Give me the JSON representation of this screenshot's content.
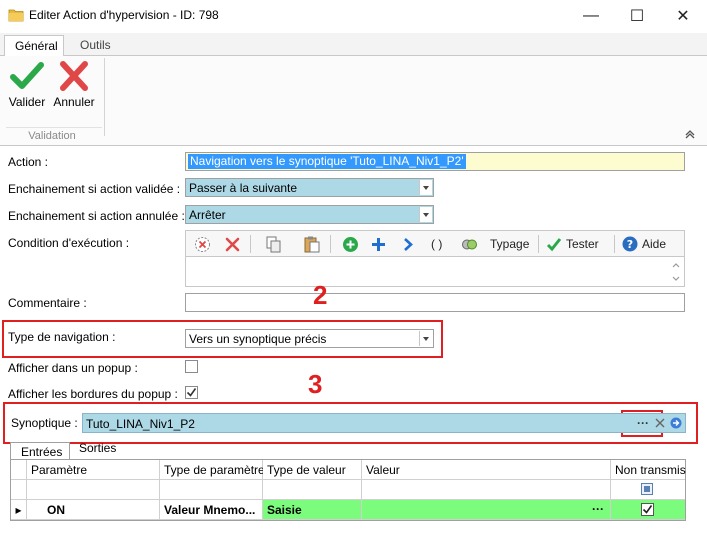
{
  "window": {
    "title": "Editer Action d'hypervision - ID: 798",
    "minimize_glyph": "—",
    "maximize_glyph": "☐",
    "close_glyph": "✕"
  },
  "ribbon": {
    "tabs": [
      "Général",
      "Outils"
    ],
    "validate_label": "Valider",
    "cancel_label": "Annuler",
    "group_label": "Validation"
  },
  "form": {
    "action_label": "Action :",
    "action_value": "Navigation vers le synoptique 'Tuto_LINA_Niv1_P2'",
    "on_valid_label": "Enchainement si action validée :",
    "on_valid_value": "Passer à la suivante",
    "on_cancel_label": "Enchainement si action annulée :",
    "on_cancel_value": "Arrêter",
    "condition_label": "Condition d'exécution :",
    "condition_toolbar": {
      "parens": "( )",
      "typage": "Typage",
      "tester": "Tester",
      "aide": "Aide"
    },
    "comment_label": "Commentaire :",
    "comment_value": "",
    "nav_type_label": "Type de navigation :",
    "nav_type_value": "Vers un synoptique précis",
    "popup_label": "Afficher dans un popup :",
    "popup_checked": false,
    "borders_label": "Afficher les bordures du popup :",
    "borders_checked": true,
    "synoptic_label": "Synoptique :",
    "synoptic_value": "Tuto_LINA_Niv1_P2",
    "synoptic_browse": "···"
  },
  "annotations": {
    "step2": "2",
    "step3": "3",
    "color": "#e02020"
  },
  "grid": {
    "tabs": [
      "Entrées",
      "Sorties"
    ],
    "columns": [
      "Paramètre",
      "Type de paramètre",
      "Type de valeur",
      "Valeur",
      "Non transmis"
    ],
    "rows": [
      {
        "indicator": "▸",
        "parametre": "ON",
        "type_parametre": "Valeur Mnemo...",
        "type_valeur": "Saisie",
        "valeur": "",
        "valeur_btn": "···",
        "non_transmis": true
      }
    ],
    "row_highlight_color": "#7cfc7c"
  }
}
